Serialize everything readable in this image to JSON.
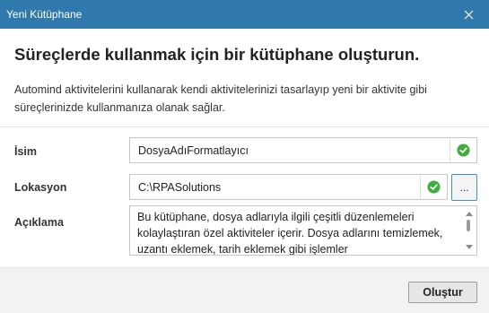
{
  "window": {
    "title": "Yeni Kütüphane",
    "close_icon": "close-icon"
  },
  "heading": "Süreçlerde kullanmak için bir kütüphane oluşturun.",
  "description": "Automind aktivitelerini kullanarak kendi aktivitelerinizi tasarlayıp yeni bir aktivite gibi süreçlerinizde kullanmanıza olanak sağlar.",
  "form": {
    "name": {
      "label": "İsim",
      "value": "DosyaAdıFormatlayıcı",
      "status_icon": "check-circle-icon"
    },
    "location": {
      "label": "Lokasyon",
      "value": "C:\\RPASolutions",
      "status_icon": "check-circle-icon",
      "browse_label": "..."
    },
    "description": {
      "label": "Açıklama",
      "value": "Bu kütüphane, dosya adlarıyla ilgili çeşitli düzenlemeleri kolaylaştıran özel aktiviteler içerir. Dosya adlarını temizlemek, uzantı eklemek, tarih eklemek gibi işlemler"
    }
  },
  "footer": {
    "create_label": "Oluştur"
  },
  "colors": {
    "titlebar": "#2f79ad",
    "valid": "#3fae3f",
    "focus_border": "#3b8ee0"
  }
}
